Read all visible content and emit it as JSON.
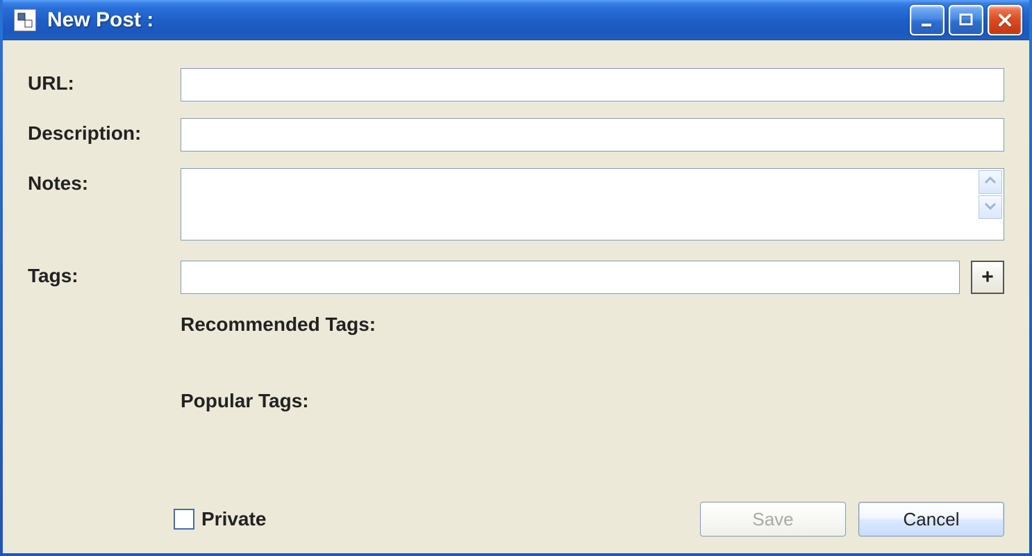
{
  "window": {
    "title": "New Post :"
  },
  "labels": {
    "url": "URL:",
    "description": "Description:",
    "notes": "Notes:",
    "tags": "Tags:",
    "recommended_tags": "Recommended Tags:",
    "popular_tags": "Popular Tags:",
    "private": "Private"
  },
  "fields": {
    "url": "",
    "description": "",
    "notes": "",
    "tags": "",
    "private_checked": false
  },
  "buttons": {
    "add_tag": "+",
    "save": "Save",
    "cancel": "Cancel"
  },
  "icons": {
    "app": "app-icon",
    "minimize": "minimize-icon",
    "maximize": "maximize-icon",
    "close": "close-icon",
    "scroll_up": "chevron-up-icon",
    "scroll_down": "chevron-down-icon"
  }
}
